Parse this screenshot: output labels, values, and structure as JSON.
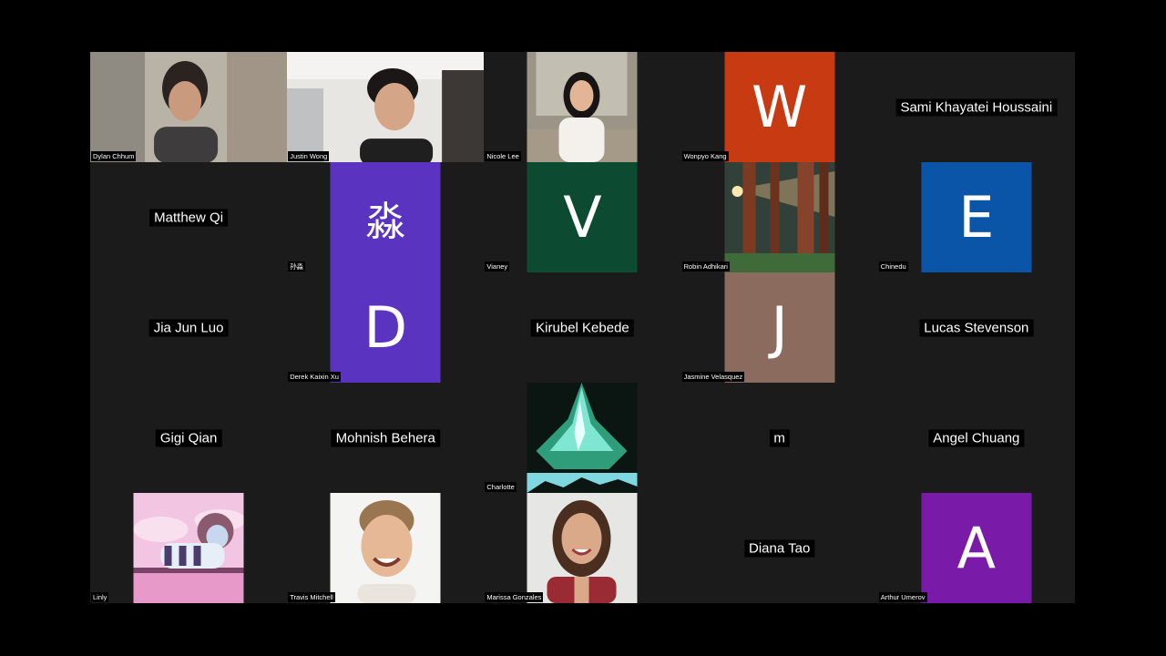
{
  "participants": {
    "r0": [
      {
        "name": "Dylan Chhum"
      },
      {
        "name": "Justin Wong"
      },
      {
        "name": "Nicole Lee"
      },
      {
        "name": "Wonpyo Kang",
        "initial": "W",
        "color": "#c83a12"
      },
      {
        "name": "Sami Khayatei Houssaini"
      }
    ],
    "r1": [
      {
        "name": "Matthew Qi"
      },
      {
        "name": "孙淼",
        "initial": "淼",
        "color": "#5a33c0"
      },
      {
        "name": "Vianey",
        "initial": "V",
        "color": "#0c4a32"
      },
      {
        "name": "Robin Adhikari"
      },
      {
        "name": "Chinedu",
        "initial": "E",
        "color": "#0b55a8"
      }
    ],
    "r2": [
      {
        "name": "Jia Jun Luo"
      },
      {
        "name": "Derek Kaixin Xu",
        "initial": "D",
        "color": "#5a33c0"
      },
      {
        "name": "Kirubel Kebede"
      },
      {
        "name": "Jasmine Velasquez",
        "initial": "J",
        "color": "#8a6b5e"
      },
      {
        "name": "Lucas Stevenson"
      }
    ],
    "r3": [
      {
        "name": "Gigi Qian"
      },
      {
        "name": "Mohnish Behera"
      },
      {
        "name": "Charlotte"
      },
      {
        "name": "m"
      },
      {
        "name": "Angel Chuang"
      }
    ],
    "r4": [
      {
        "name": "Linly"
      },
      {
        "name": "Travis Mitchell"
      },
      {
        "name": "Marissa Gonzales"
      },
      {
        "name": "Diana Tao"
      },
      {
        "name": "Arthur Umerov",
        "initial": "A",
        "color": "#7a1aa8"
      }
    ]
  }
}
